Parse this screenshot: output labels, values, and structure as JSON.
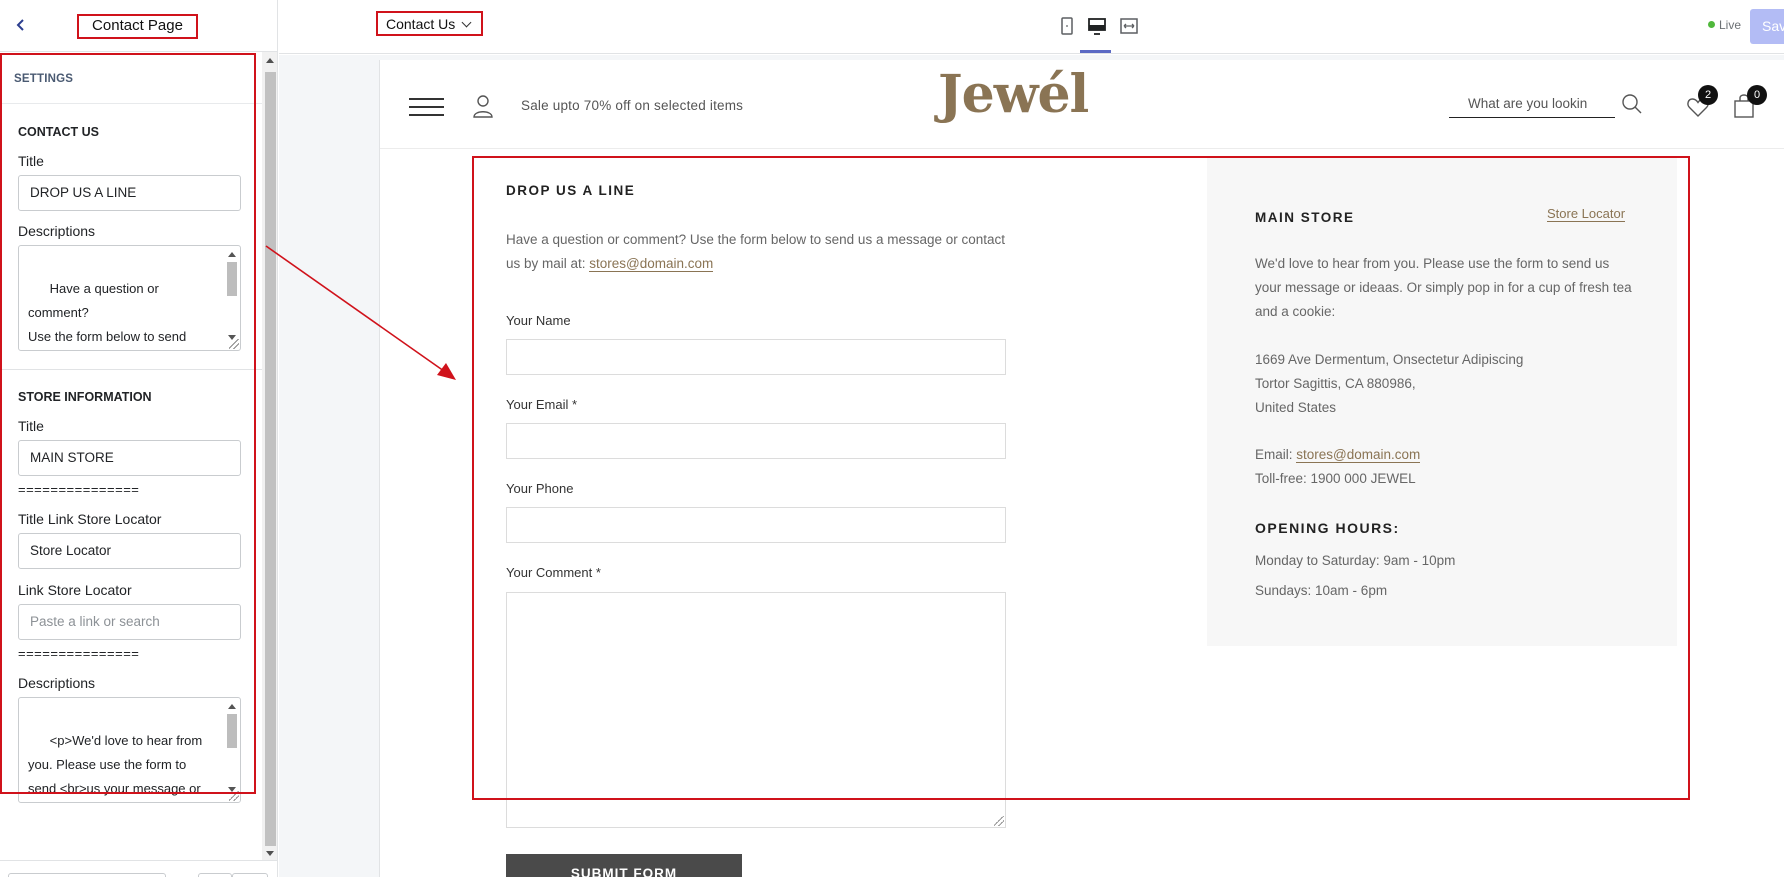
{
  "editor": {
    "page_title": "Contact Page",
    "page_selector": "Contact Us",
    "live_label": "Live",
    "save_label": "Save"
  },
  "sidebar": {
    "settings_label": "SETTINGS",
    "contact_section": {
      "heading": "CONTACT US",
      "title_label": "Title",
      "title_value": "DROP US A LINE",
      "descriptions_label": "Descriptions",
      "descriptions_value": "Have a question or comment?\nUse the form below to send\nus a message\nor contact us by mail at: <a"
    },
    "store_section": {
      "heading": "STORE INFORMATION",
      "title_label": "Title",
      "title_value": "MAIN STORE",
      "divider_1": "===============",
      "link_title_label": "Title Link Store Locator",
      "link_title_value": "Store Locator",
      "link_label": "Link Store Locator",
      "link_placeholder": "Paste a link or search",
      "divider_2": "===============",
      "descriptions_label": "Descriptions",
      "descriptions_value": "<p>We'd love to hear from\nyou. Please use the form to\nsend <br>us your message or\nideaas. Or simply pop in for a"
    }
  },
  "store_header": {
    "promo": "Sale upto 70% off on selected items",
    "logo": "Jewél",
    "search_placeholder": "What are you lookin",
    "wishlist_count": "2",
    "cart_count": "0"
  },
  "contact_form": {
    "heading": "DROP US A LINE",
    "description": "Have a question or comment? Use the form below to send us a message or contact us by mail at: ",
    "email_link": "stores@domain.com",
    "name_label": "Your Name",
    "email_label": "Your Email *",
    "phone_label": "Your Phone",
    "comment_label": "Your Comment *",
    "submit_label": "SUBMIT FORM"
  },
  "store_info": {
    "heading": "MAIN STORE",
    "locator_link": "Store Locator",
    "intro": "We'd love to hear from you. Please use the form to send us your message or ideaas. Or simply pop in for a cup of fresh tea and a cookie:",
    "address_line_1": "1669 Ave Dermentum, Onsectetur Adipiscing",
    "address_line_2": "Tortor Sagittis, CA 880986,",
    "address_line_3": "United States",
    "email_label": "Email: ",
    "email_value": "stores@domain.com",
    "tollfree": "Toll-free: 1900 000 JEWEL",
    "hours_heading": "OPENING HOURS:",
    "hours_weekday": "Monday to Saturday: 9am - 10pm",
    "hours_sunday": "Sundays: 10am - 6pm"
  },
  "colors": {
    "annotation_red": "#d0121b",
    "brand_gold": "#8a7454",
    "active_tab": "#5c6ac4",
    "save_button": "#b3bcf5"
  }
}
